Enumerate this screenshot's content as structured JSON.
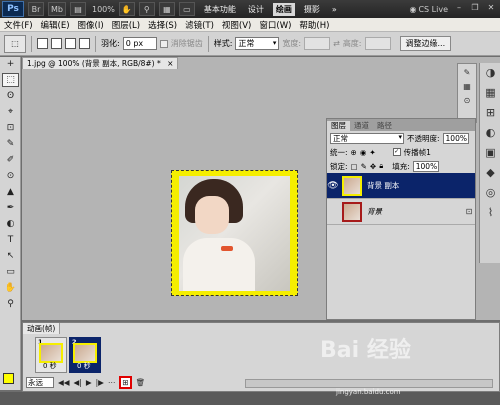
{
  "app": {
    "logo": "Ps",
    "zoom": "100%",
    "workspaces": [
      "基本功能",
      "设计",
      "绘画",
      "摄影"
    ],
    "active_workspace": "绘画",
    "cs_live": "CS Live"
  },
  "menu": [
    "文件(F)",
    "编辑(E)",
    "图像(I)",
    "图层(L)",
    "选择(S)",
    "滤镜(T)",
    "视图(V)",
    "窗口(W)",
    "帮助(H)"
  ],
  "options": {
    "feather_label": "羽化:",
    "feather_value": "0 px",
    "antialias_label": "消除锯齿",
    "style_label": "样式:",
    "style_value": "正常",
    "width_label": "宽度:",
    "height_label": "高度:",
    "refine_button": "调整边缘..."
  },
  "document": {
    "tab_title": "1.jpg @ 100% (背景 副本, RGB/8#) *",
    "close": "×"
  },
  "tools": [
    "+",
    "⬚",
    "ʘ",
    "⌖",
    "⊡",
    "✎",
    "✐",
    "⊙",
    "▲",
    "✒",
    "◐",
    "T",
    "↖",
    "▭",
    "✋",
    "⚲"
  ],
  "layers_panel": {
    "tabs": [
      "图层",
      "通道",
      "路径"
    ],
    "blend_mode": "正常",
    "opacity_label": "不透明度:",
    "opacity_value": "100%",
    "unify_label": "统一:",
    "propagate_label": "传播帧1",
    "lock_label": "锁定:",
    "fill_label": "填充:",
    "fill_value": "100%",
    "layers": [
      {
        "name": "背景 副本",
        "selected": true
      },
      {
        "name": "背景",
        "selected": false
      }
    ]
  },
  "animation_panel": {
    "tab_label": "动画(帧)",
    "frames": [
      {
        "number": "1",
        "time": "0 秒"
      },
      {
        "number": "2",
        "time": "0 秒"
      }
    ],
    "loop_value": "永远"
  },
  "watermark": {
    "brand": "Bai 经验",
    "url": "jingyan.baidu.com"
  }
}
